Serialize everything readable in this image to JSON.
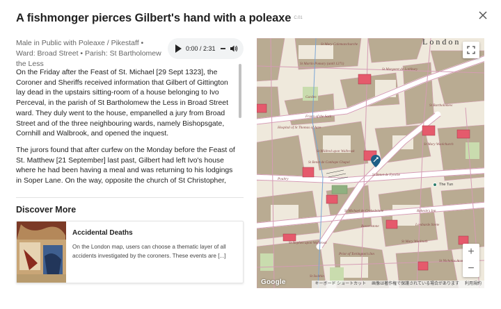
{
  "title": "A fishmonger pierces Gilbert's hand with a poleaxe",
  "title_code": "C.01",
  "meta": "Male in Public with Poleaxe / Pikestaff • Ward: Broad Street • Parish: St Bartholomew the Less",
  "audio": {
    "time": "0:00 / 2:31"
  },
  "story": [
    "On the Friday after the Feast of St. Michael [29 Sept 1323], the Coroner and Sheriffs received information that Gilbert of Gittington lay dead in the upstairs sitting-room of a house belonging to Ivo Perceval, in the parish of St Bartholomew the Less in Broad Street ward. They duly went to the house, empanelled a jury from Broad Street and of the three neighbouring wards, namely Bishopsgate, Cornhill and Walbrook, and opened the inquest.",
    "The jurors found that after curfew on the Monday before the Feast of St. Matthew [21 September] last past, Gilbert had left Ivo's house where he had been having a meal and was returning to his lodgings in Soper Lane. On the way, opposite the church of St Christopher, he quarrelled with"
  ],
  "discover": {
    "heading": "Discover More",
    "card_title": "Accidental Deaths",
    "card_desc": "On the London map, users can choose a thematic layer of all accidents investigated by the coroners. These events are [...]"
  },
  "map": {
    "london": "London",
    "google": "Google",
    "attribution": [
      "キーボード ショートカット",
      "画像は著作権で保護されている場合があります",
      "利用規約"
    ],
    "poi": "The Tun",
    "labels": [
      "St Mary Colemanchurche",
      "St Martin Pomary (until 1271)",
      "St Margaret de Lothbury",
      "Garden",
      "Friars of the Sack",
      "Hospital of St Thomas of Acre",
      "St Bartholomew",
      "St Mildred upon Walbrook",
      "St Benet de Conhope Chapel",
      "St Mary Woolchurch",
      "St Benet de Fynche",
      "St Mary Woolnoth",
      "Poultry",
      "Rokesle's Inn",
      "St Michael de Crokedelane",
      "St Stephen upon Walbrook",
      "St Swithin",
      "Prior of Tortington's Inn",
      "Bassenstone",
      "St Nicholas Acon",
      "Lombarde Strete"
    ]
  },
  "colors": {
    "roads": "#d59cb4",
    "buildings": "#b9ab92",
    "water": "#7aa6d6",
    "landmark": "#e55a6c"
  }
}
